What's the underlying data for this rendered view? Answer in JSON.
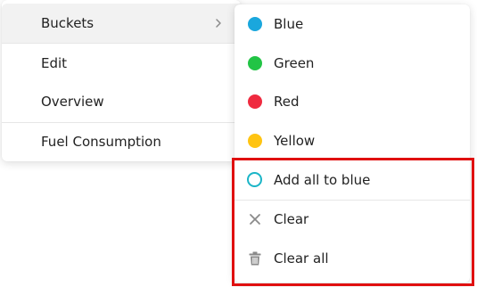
{
  "main_menu": {
    "items": [
      {
        "label": "Buckets"
      },
      {
        "label": "Edit"
      },
      {
        "label": "Overview"
      },
      {
        "label": "Fuel Consumption"
      }
    ]
  },
  "sub_menu": {
    "items": [
      {
        "label": "Blue",
        "color": "#1aa7dd"
      },
      {
        "label": "Green",
        "color": "#22c445"
      },
      {
        "label": "Red",
        "color": "#ef2a3f"
      },
      {
        "label": "Yellow",
        "color": "#ffc412"
      },
      {
        "label": "Add all to blue",
        "icon": "circle-outline-icon"
      },
      {
        "label": "Clear",
        "icon": "x-icon"
      },
      {
        "label": "Clear all",
        "icon": "trash-icon"
      }
    ]
  },
  "colors": {
    "highlight_border": "#e01010",
    "ring": "#1bb5c7",
    "icon_gray": "#8a8a8a"
  }
}
